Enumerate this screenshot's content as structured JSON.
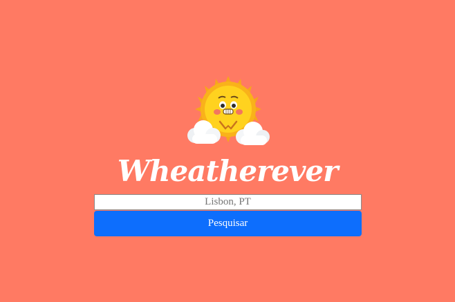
{
  "app": {
    "title": "Wheatherever",
    "mascot_icon": "sun-with-clouds-icon"
  },
  "search": {
    "placeholder": "Lisbon, PT",
    "value": "",
    "button_label": "Pesquisar"
  },
  "colors": {
    "background": "#ff7a63",
    "button": "#0d6efd",
    "title": "#ffffff"
  }
}
